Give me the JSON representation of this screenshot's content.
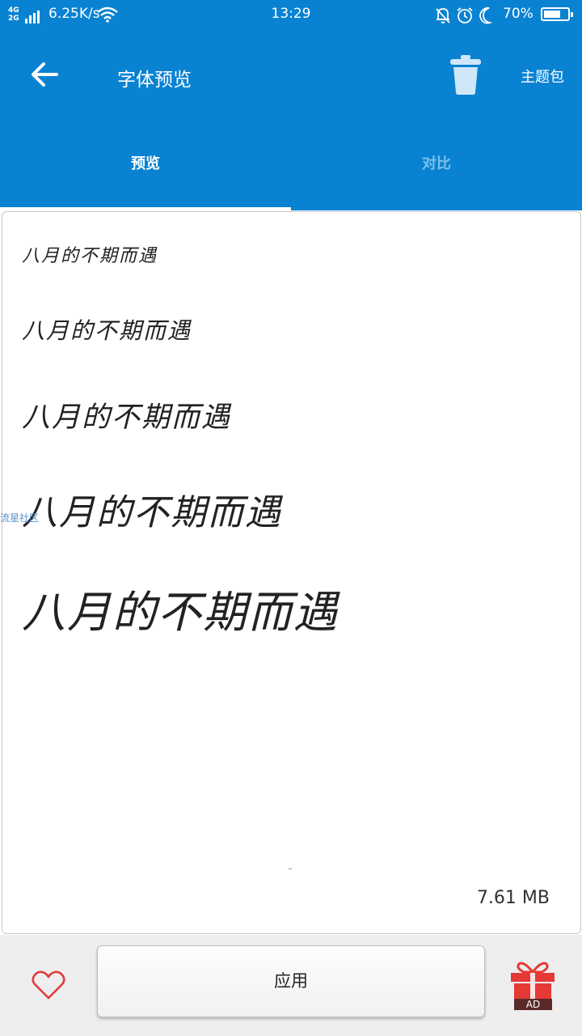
{
  "status_bar": {
    "network_top": "4G",
    "network_bottom": "2G",
    "speed": "6.25K/s",
    "time": "13:29",
    "battery": "70%",
    "battery_level": 0.7
  },
  "header": {
    "title": "字体预览",
    "theme_pack": "主题包",
    "accent_color": "#0a82d2"
  },
  "tabs": [
    {
      "label": "预览",
      "active": true
    },
    {
      "label": "对比",
      "active": false
    }
  ],
  "preview": {
    "samples": [
      "八月的不期而遇",
      "八月的不期而遇",
      "八月的不期而遇",
      "八月的不期而遇",
      "八月的不期而遇"
    ],
    "watermark": "流星社区",
    "file_size": "7.61 MB"
  },
  "bottom_bar": {
    "apply_label": "应用",
    "ad_label": "AD"
  },
  "icons": [
    "back-arrow-icon",
    "trash-icon",
    "heart-icon",
    "gift-icon",
    "wifi-icon",
    "bell-mute-icon",
    "alarm-icon",
    "moon-icon",
    "battery-icon"
  ]
}
